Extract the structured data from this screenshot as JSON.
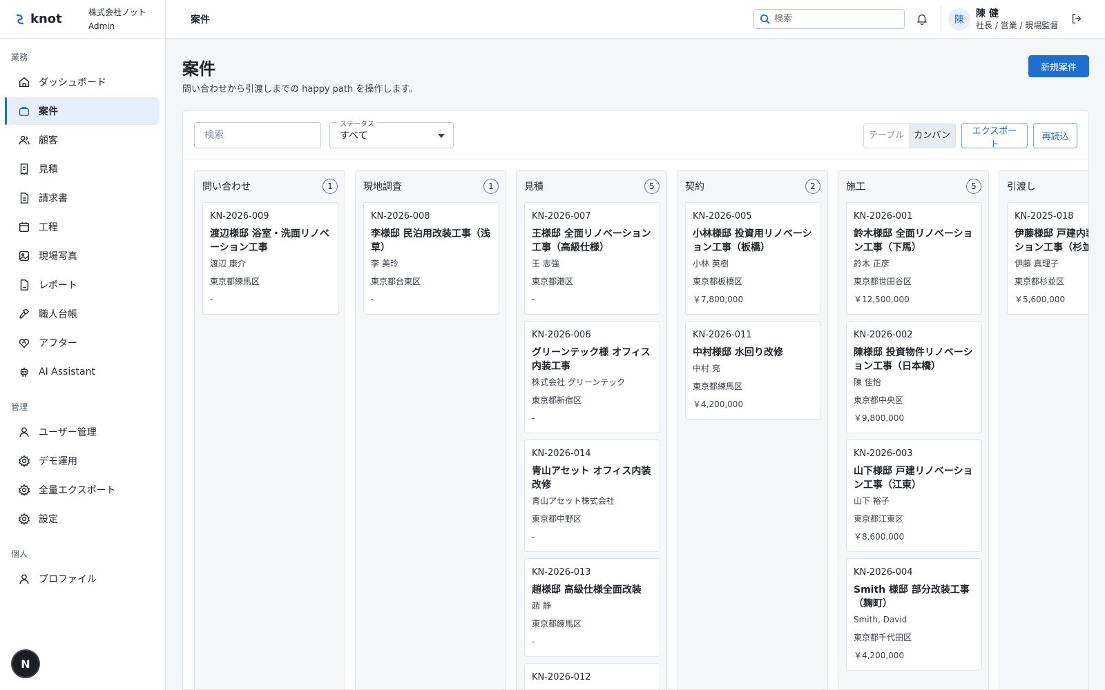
{
  "brand": {
    "name": "knot",
    "org_name": "株式会社ノット",
    "org_role": "Admin"
  },
  "topbar": {
    "breadcrumb": "案件",
    "search_placeholder": "検索",
    "user_initial": "陳",
    "user_name": "陳 健",
    "user_roles": "社長 / 営業 / 現場監督"
  },
  "sidebar": {
    "sections": [
      {
        "label": "業務",
        "items": [
          {
            "label": "ダッシュボード",
            "icon": "home-icon"
          },
          {
            "label": "案件",
            "icon": "briefcase-icon",
            "active": true
          },
          {
            "label": "顧客",
            "icon": "users-icon"
          },
          {
            "label": "見積",
            "icon": "receipt-icon"
          },
          {
            "label": "請求書",
            "icon": "document-icon"
          },
          {
            "label": "工程",
            "icon": "calendar-icon"
          },
          {
            "label": "現場写真",
            "icon": "image-icon"
          },
          {
            "label": "レポート",
            "icon": "report-icon"
          },
          {
            "label": "職人台帳",
            "icon": "hammer-icon"
          },
          {
            "label": "アフター",
            "icon": "heart-handshake-icon"
          },
          {
            "label": "AI Assistant",
            "icon": "robot-icon"
          }
        ]
      },
      {
        "label": "管理",
        "items": [
          {
            "label": "ユーザー管理",
            "icon": "user-icon"
          },
          {
            "label": "デモ運用",
            "icon": "gear-icon"
          },
          {
            "label": "全量エクスポート",
            "icon": "gear-icon"
          },
          {
            "label": "設定",
            "icon": "gear-icon"
          }
        ]
      },
      {
        "label": "個人",
        "items": [
          {
            "label": "プロファイル",
            "icon": "user-icon"
          }
        ]
      }
    ],
    "next_badge": "N"
  },
  "page": {
    "title": "案件",
    "subtitle": "問い合わせから引渡しまでの happy path を操作します。",
    "new_button": "新規案件"
  },
  "filters": {
    "search_placeholder": "検索",
    "status_legend": "ステータス",
    "status_value": "すべて",
    "view_table": "テーブル",
    "view_kanban": "カンバン",
    "export": "エクスポート",
    "reload": "再読込"
  },
  "columns": [
    {
      "name": "問い合わせ",
      "count": "1",
      "cards": [
        {
          "code": "KN-2026-009",
          "title": "渡辺様邸 浴室・洗面リノベーション工事",
          "customer": "渡辺 康介",
          "area": "東京都練馬区",
          "amount": "-"
        }
      ]
    },
    {
      "name": "現地調査",
      "count": "1",
      "cards": [
        {
          "code": "KN-2026-008",
          "title": "李様邸 民泊用改装工事（浅草）",
          "customer": "李 美玲",
          "area": "東京都台東区",
          "amount": "-"
        }
      ]
    },
    {
      "name": "見積",
      "count": "5",
      "cards": [
        {
          "code": "KN-2026-007",
          "title": "王様邸 全面リノベーション工事（高級仕様）",
          "customer": "王 志強",
          "area": "東京都港区",
          "amount": "-"
        },
        {
          "code": "KN-2026-006",
          "title": "グリーンテック様 オフィス内装工事",
          "customer": "株式会社 グリーンテック",
          "area": "東京都新宿区",
          "amount": "-"
        },
        {
          "code": "KN-2026-014",
          "title": "青山アセット オフィス内装改修",
          "customer": "青山アセット株式会社",
          "area": "東京都中野区",
          "amount": "-"
        },
        {
          "code": "KN-2026-013",
          "title": "趙様邸 高級仕様全面改装",
          "customer": "趙 静",
          "area": "東京都練馬区",
          "amount": "-"
        },
        {
          "code": "KN-2026-012",
          "title": "",
          "customer": "",
          "area": "",
          "amount": ""
        }
      ]
    },
    {
      "name": "契約",
      "count": "2",
      "cards": [
        {
          "code": "KN-2026-005",
          "title": "小林様邸 投資用リノベーション工事（板橋）",
          "customer": "小林 英樹",
          "area": "東京都板橋区",
          "amount": "￥7,800,000"
        },
        {
          "code": "KN-2026-011",
          "title": "中村様邸 水回り改修",
          "customer": "中村 亮",
          "area": "東京都練馬区",
          "amount": "￥4,200,000"
        }
      ]
    },
    {
      "name": "施工",
      "count": "5",
      "cards": [
        {
          "code": "KN-2026-001",
          "title": "鈴木様邸 全面リノベーション工事（下馬）",
          "customer": "鈴木 正彦",
          "area": "東京都世田谷区",
          "amount": "￥12,500,000"
        },
        {
          "code": "KN-2026-002",
          "title": "陳様邸 投資物件リノベーション工事（日本橋）",
          "customer": "陳 佳怡",
          "area": "東京都中央区",
          "amount": "￥9,800,000"
        },
        {
          "code": "KN-2026-003",
          "title": "山下様邸 戸建リノベーション工事（江東）",
          "customer": "山下 裕子",
          "area": "東京都江東区",
          "amount": "￥8,600,000"
        },
        {
          "code": "KN-2026-004",
          "title": "Smith 様邸 部分改装工事（麹町）",
          "customer": "Smith, David",
          "area": "東京都千代田区",
          "amount": "￥4,200,000"
        }
      ]
    },
    {
      "name": "引渡し",
      "count": "",
      "cards": [
        {
          "code": "KN-2025-018",
          "title": "伊藤様邸 戸建内装リノベーション工事（杉並）",
          "customer": "伊藤 真理子",
          "area": "東京都杉並区",
          "amount": "￥5,600,000"
        }
      ]
    }
  ]
}
